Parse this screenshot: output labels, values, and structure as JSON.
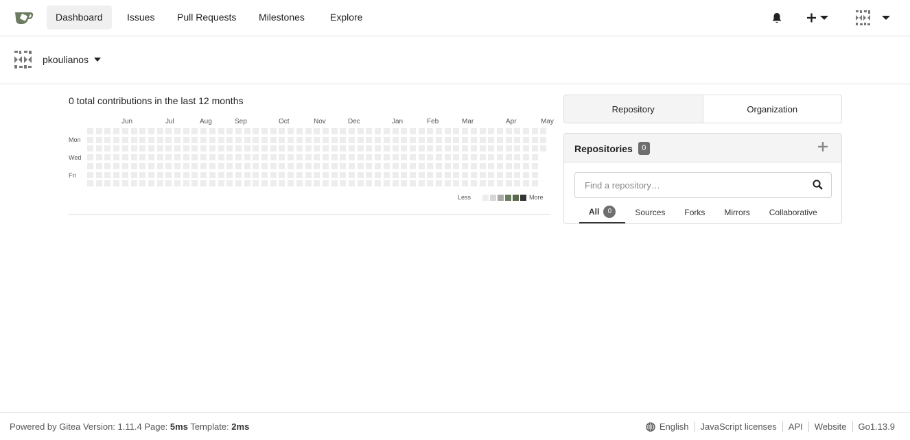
{
  "navbar": {
    "logo_icon": "gitea-teacup-logo",
    "items": [
      {
        "label": "Dashboard",
        "active": true
      },
      {
        "label": "Issues"
      },
      {
        "label": "Pull Requests"
      },
      {
        "label": "Milestones"
      },
      {
        "label": "Explore"
      }
    ],
    "notification_icon": "bell-icon",
    "create_icon": "plus-icon",
    "user_avatar_icon": "identicon-avatar"
  },
  "context": {
    "username": "pkoulianos"
  },
  "heatmap": {
    "title": "0 total contributions in the last 12 months",
    "months": [
      "Jun",
      "Jul",
      "Aug",
      "Sep",
      "Oct",
      "Nov",
      "Dec",
      "Jan",
      "Feb",
      "Mar",
      "Apr",
      "May"
    ],
    "days": [
      "Mon",
      "Wed",
      "Fri"
    ],
    "legend_less": "Less",
    "legend_more": "More",
    "legend_colors": [
      "#ededed",
      "#d6d8d6",
      "#a7aaa7",
      "#6b7c61",
      "#596b4c",
      "#333333"
    ],
    "empty_color": "#ededed"
  },
  "dashboard_switch": {
    "repository_label": "Repository",
    "organization_label": "Organization"
  },
  "repos": {
    "title": "Repositories",
    "count": "0",
    "search_placeholder": "Find a repository…",
    "tabs": [
      {
        "label": "All",
        "count": "0",
        "active": true
      },
      {
        "label": "Sources"
      },
      {
        "label": "Forks"
      },
      {
        "label": "Mirrors"
      },
      {
        "label": "Collaborative"
      }
    ]
  },
  "footer": {
    "powered": "Powered by Gitea Version: 1.11.4 Page: ",
    "page_time": "5ms",
    "template_label": " Template: ",
    "template_time": "2ms",
    "language": "English",
    "js_licenses": "JavaScript licenses",
    "api": "API",
    "website": "Website",
    "go_version": "Go1.13.9"
  }
}
